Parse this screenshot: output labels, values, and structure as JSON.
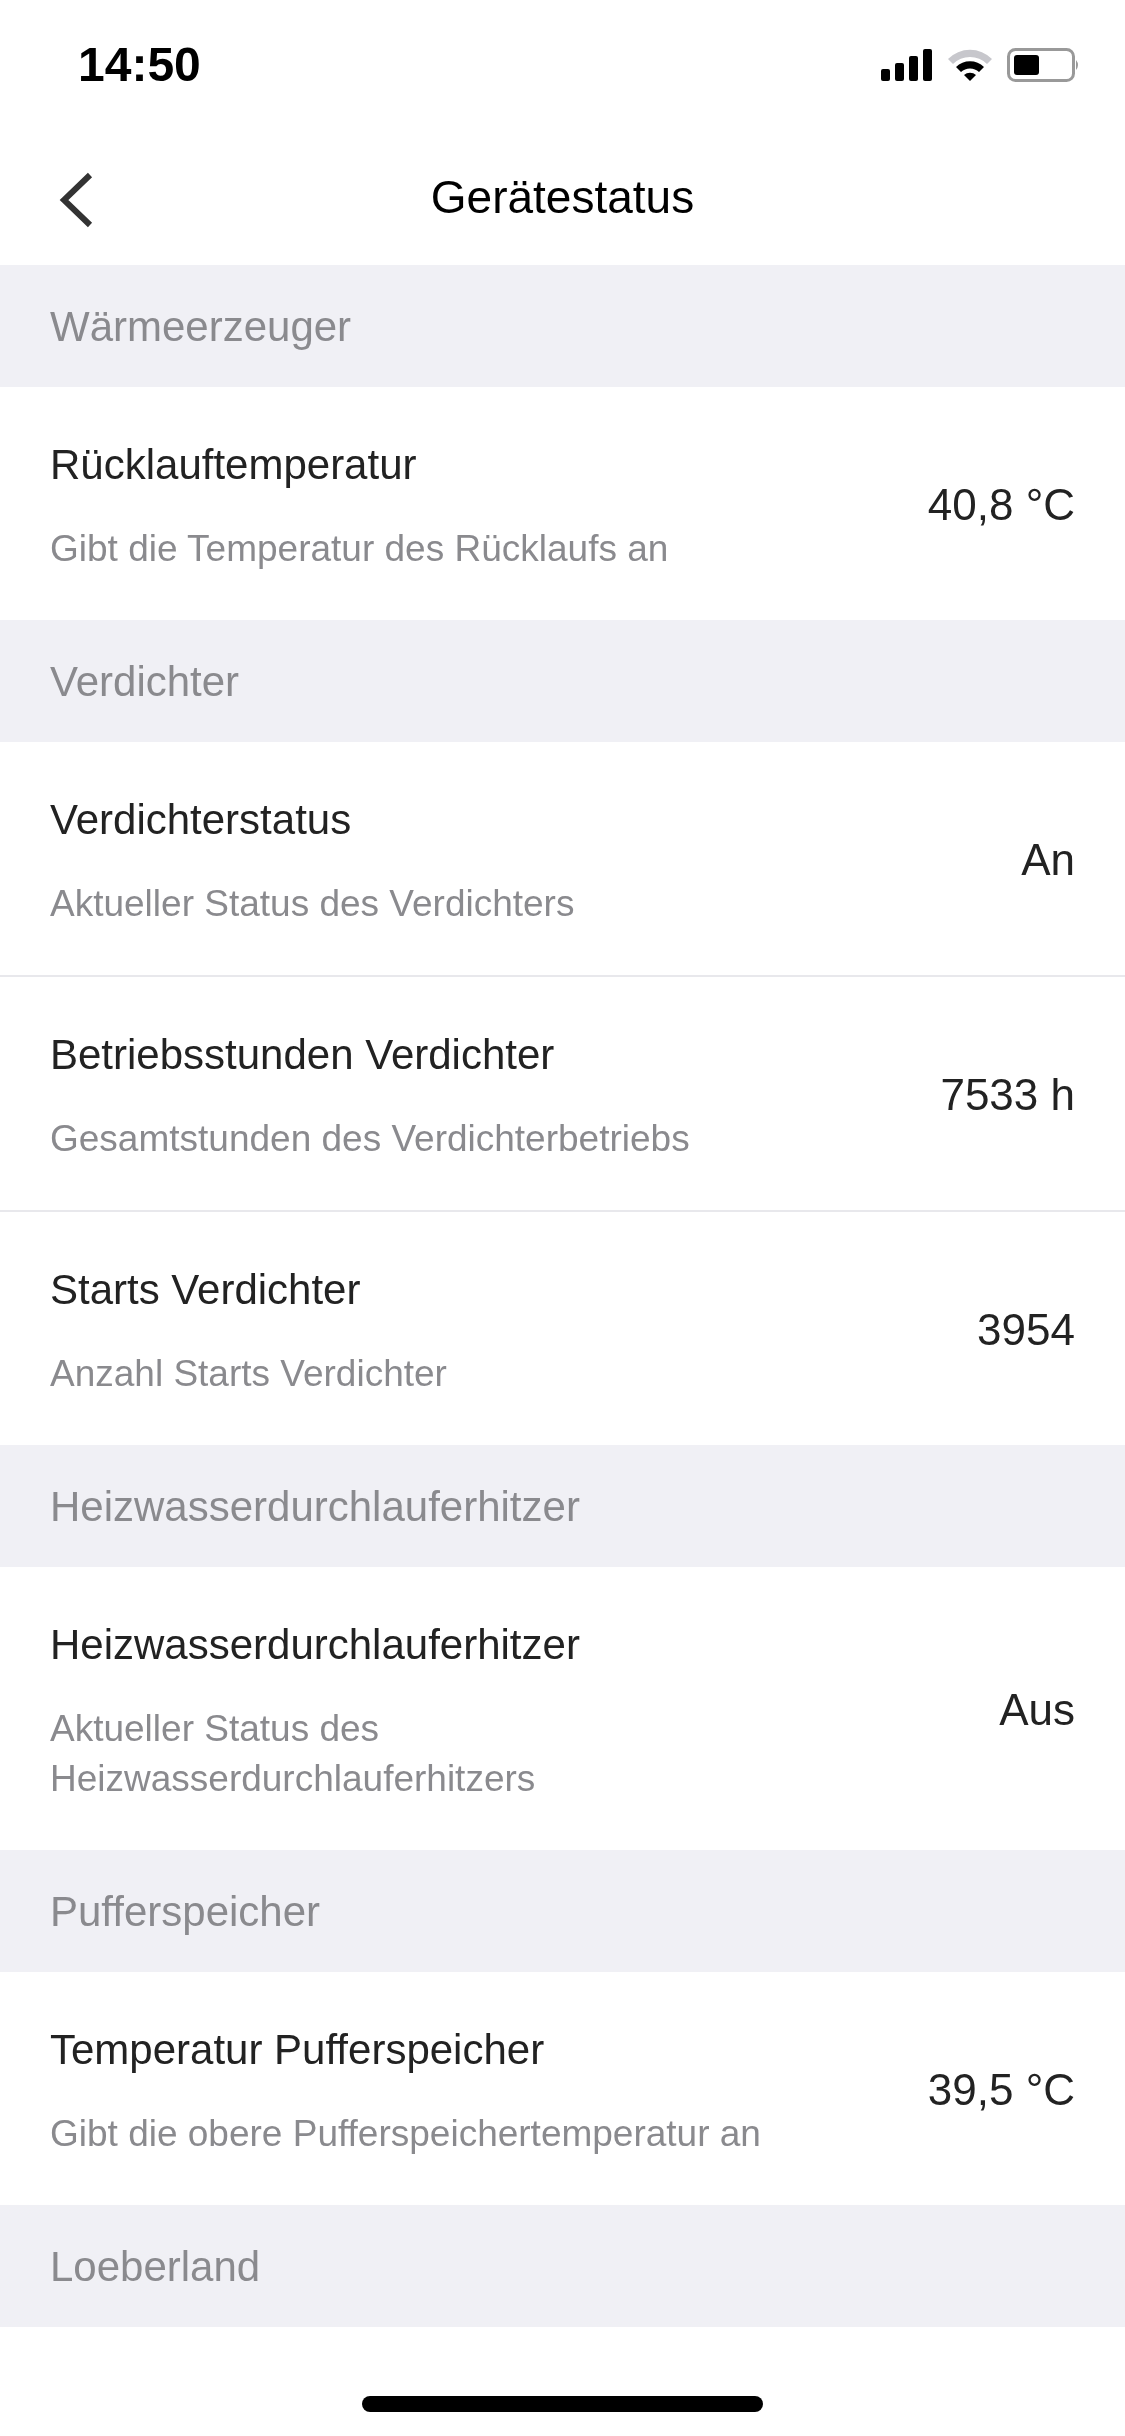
{
  "status_bar": {
    "time": "14:50"
  },
  "nav": {
    "title": "Gerätestatus"
  },
  "sections": [
    {
      "title": "Wärmeerzeuger",
      "rows": [
        {
          "title": "Rücklauftemperatur",
          "description": "Gibt die Temperatur des Rücklaufs an",
          "value": "40,8 °C"
        }
      ]
    },
    {
      "title": "Verdichter",
      "rows": [
        {
          "title": "Verdichterstatus",
          "description": "Aktueller Status des Verdichters",
          "value": "An"
        },
        {
          "title": "Betriebsstunden Verdichter",
          "description": "Gesamtstunden des Verdichterbetriebs",
          "value": "7533 h"
        },
        {
          "title": "Starts Verdichter",
          "description": "Anzahl Starts Verdichter",
          "value": "3954"
        }
      ]
    },
    {
      "title": "Heizwasserdurchlauferhitzer",
      "rows": [
        {
          "title": "Heizwasserdurchlauferhitzer",
          "description": "Aktueller Status des Heizwasserdurchlauferhitzers",
          "value": "Aus"
        }
      ]
    },
    {
      "title": "Pufferspeicher",
      "rows": [
        {
          "title": "Temperatur Pufferspeicher",
          "description": "Gibt die obere Pufferspeichertemperatur an",
          "value": "39,5 °C"
        }
      ]
    },
    {
      "title": "Loeberland"
    }
  ]
}
